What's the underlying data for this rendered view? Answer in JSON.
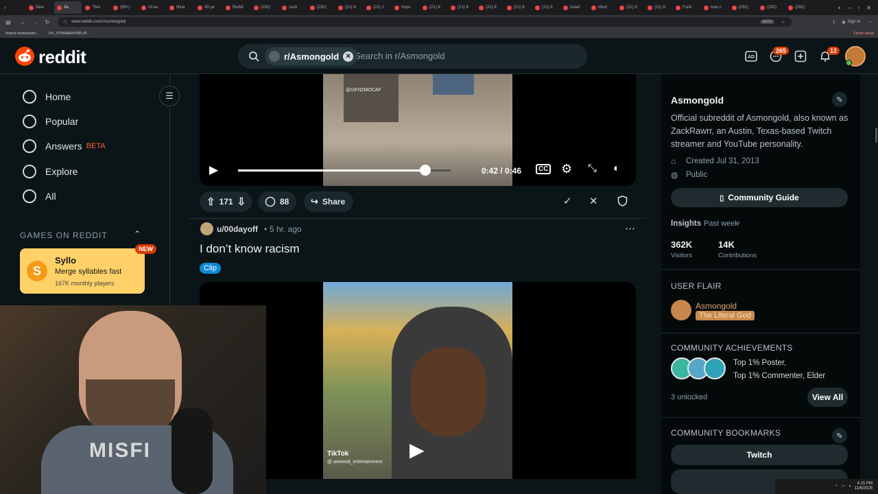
{
  "browser": {
    "tabs": [
      "New",
      "As",
      "\"Sex",
      "(99+)",
      "r/Live",
      "Nina",
      "43 ye",
      "Reddi",
      "(292)",
      "zack",
      "(292)",
      "(21) K",
      "(21) J",
      "Impo",
      "(21) K",
      "(21) K",
      "(21) K",
      "(21) K",
      "(21) K",
      "israel",
      "Most",
      "(21) K",
      "(21) D",
      "Funk",
      "how c",
      "(292)",
      "(292)",
      "(292)"
    ],
    "url": "www.reddit.com/r/Asmongold/",
    "zoom": "180%",
    "sign_in": "Sign in",
    "bookmarks": [
      "Import bookmarks...",
      "G4_7t7fXAAAhVM3 (P..."
    ],
    "finish_setup": "Finish setup"
  },
  "header": {
    "logo_text": "reddit",
    "search_chip": "r/Asmongold",
    "search_placeholder": "Search in r/Asmongold",
    "chat_count": "265",
    "notif_count": "12"
  },
  "leftnav": {
    "items": [
      {
        "label": "Home",
        "icon": "home-icon"
      },
      {
        "label": "Popular",
        "icon": "popular-icon"
      },
      {
        "label": "Answers",
        "icon": "answers-icon",
        "badge": "BETA"
      },
      {
        "label": "Explore",
        "icon": "explore-icon"
      },
      {
        "label": "All",
        "icon": "all-icon"
      }
    ],
    "games_heading": "GAMES ON REDDIT",
    "game": {
      "name": "Syllo",
      "tagline": "Merge syllables fast",
      "players": "167K monthly players",
      "badge": "NEW"
    }
  },
  "post1": {
    "watermark": "@GENZMOCAF",
    "time": "0:42 / 0:46",
    "progress": 0.88,
    "upvotes": "171",
    "comments": "88",
    "share": "Share"
  },
  "post2": {
    "author": "u/00dayoff",
    "age": "5 hr. ago",
    "title": "I don’t know racism",
    "flair": "Clip",
    "tiktok": "TikTok",
    "tiktok_user": "@ aewood_entertainment"
  },
  "sidebar": {
    "name": "Asmongold",
    "description": "Official subreddit of Asmongold, also known as ZackRawrr, an Austin, Texas-based Twitch streamer and YouTube personality.",
    "created": "Created Jul 31, 2013",
    "visibility": "Public",
    "guide_button": "Community Guide",
    "insights_label": "Insights",
    "insights_period": "Past week",
    "visitors_value": "362K",
    "visitors_label": "Visitors",
    "contrib_value": "14K",
    "contrib_label": "Contributions",
    "flair_heading": "USER FLAIR",
    "flair_user": "Asmongold",
    "flair_text": "The Literal God",
    "achievements_heading": "COMMUNITY ACHIEVEMENTS",
    "achievements_line1": "Top 1% Poster,",
    "achievements_line2": "Top 1% Commenter, Elder",
    "unlocked": "3 unlocked",
    "view_all": "View All",
    "bookmarks_heading": "COMMUNITY BOOKMARKS",
    "bookmark_1": "Twitch"
  },
  "webcam": {
    "shirt_text": "MISFI"
  },
  "taskbar": {
    "time": "4:15 PM",
    "date": "11/6/2025"
  },
  "colors": {
    "accent": "#ff4500",
    "flair_bg": "#c88a4a",
    "clip_flair": "#0a8ad6"
  }
}
